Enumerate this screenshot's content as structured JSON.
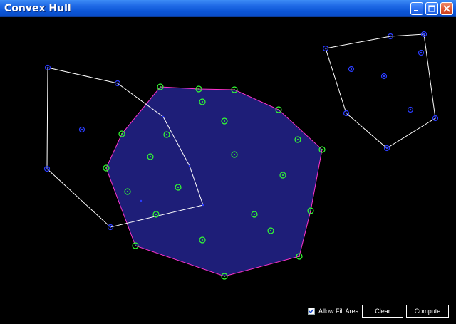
{
  "window": {
    "title": "Convex Hull",
    "controls": [
      "minimize",
      "maximize",
      "close"
    ]
  },
  "icons": {
    "minimize": "minimize-icon",
    "maximize": "maximize-icon",
    "close": "close-icon",
    "checkbox_check": "checkmark-icon"
  },
  "controls": {
    "allow_fill_area": {
      "label": "Allow Fill Area",
      "checked": true
    },
    "clear_label": "Clear",
    "compute_label": "Compute"
  },
  "colors": {
    "background": "#000000",
    "hull_fill": "#1e1e78",
    "hull_stroke": "#ff33cc",
    "hull_point_ring": "#33ff33",
    "point_center": "#2244ff",
    "outline": "#ffffff",
    "titlebar": "#0b55d6"
  }
}
